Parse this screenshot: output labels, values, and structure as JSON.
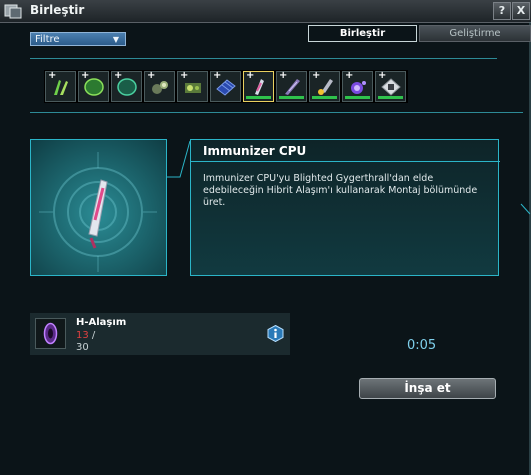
{
  "window": {
    "title": "Birleştir",
    "help_label": "?",
    "close_label": "X"
  },
  "tabs": [
    {
      "label": "Birleştir",
      "active": true
    },
    {
      "label": "Geliştirme",
      "active": false
    }
  ],
  "filter": {
    "label": "Filtre",
    "arrow": "▼"
  },
  "items": [
    {
      "icon": "ammo-icon",
      "plus": "+",
      "has_bar": false,
      "selected": false
    },
    {
      "icon": "shield-icon",
      "plus": "+",
      "has_bar": false,
      "selected": false
    },
    {
      "icon": "generator-icon",
      "plus": "+",
      "has_bar": false,
      "selected": false
    },
    {
      "icon": "drone-icon",
      "plus": "+",
      "has_bar": false,
      "selected": false
    },
    {
      "icon": "module-icon",
      "plus": "+",
      "has_bar": false,
      "selected": false
    },
    {
      "icon": "grid-icon",
      "plus": "+",
      "has_bar": false,
      "selected": false
    },
    {
      "icon": "cpu-icon",
      "plus": "+",
      "has_bar": true,
      "selected": true
    },
    {
      "icon": "blade-icon",
      "plus": "+",
      "has_bar": true,
      "selected": false
    },
    {
      "icon": "launcher-icon",
      "plus": "+",
      "has_bar": true,
      "selected": false
    },
    {
      "icon": "orb-icon",
      "plus": "+",
      "has_bar": true,
      "selected": false
    },
    {
      "icon": "chip-icon",
      "plus": "+",
      "has_bar": true,
      "selected": false
    }
  ],
  "detail": {
    "title": "Immunizer CPU",
    "description": "Immunizer CPU'yu Blighted Gygerthrall'dan elde edebileceğin Hibrit Alaşım'ı kullanarak Montaj bölümünde üret."
  },
  "requirement": {
    "name": "H-Alaşım",
    "have": "13",
    "separator": " /",
    "need": "30"
  },
  "timer": "0:05",
  "build_button": "İnşa et",
  "colors": {
    "accent": "#2bb5c8",
    "selected_border": "#e8d060",
    "bar_green": "#2fc24c",
    "insufficient": "#e04040",
    "timer": "#7fd0ec"
  }
}
